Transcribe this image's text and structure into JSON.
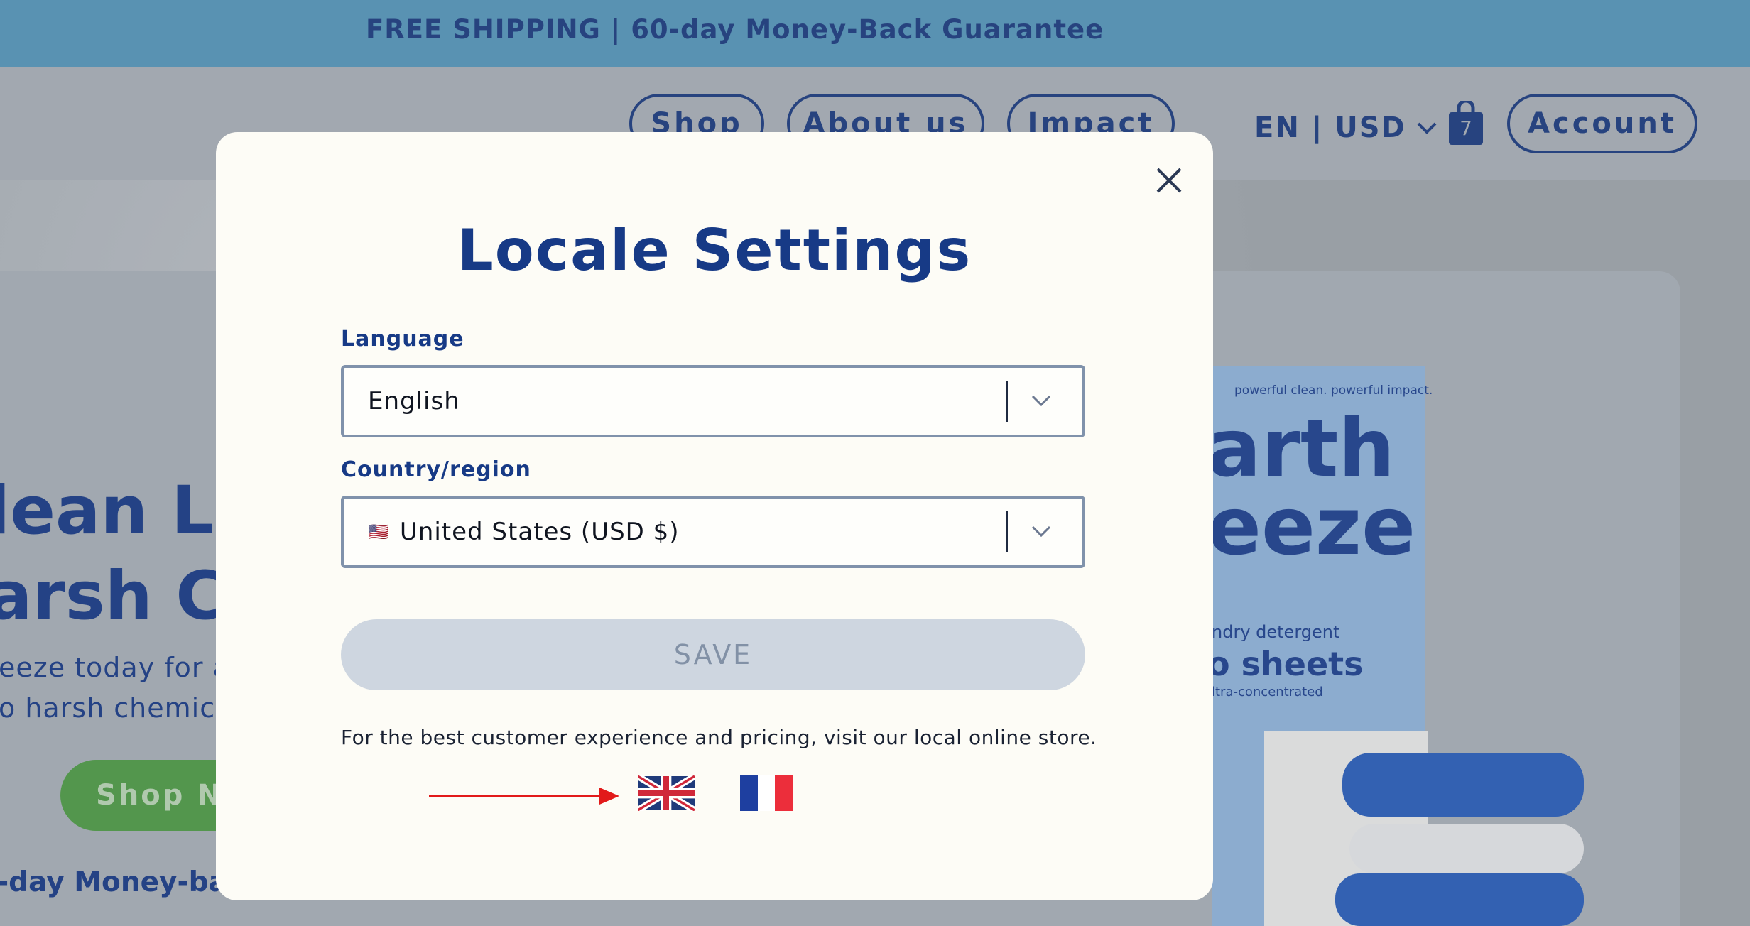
{
  "announcement": {
    "text": "FREE SHIPPING | 60-day Money-Back Guarantee"
  },
  "header": {
    "nav": [
      {
        "label": "Shop"
      },
      {
        "label": "About us"
      },
      {
        "label": "Impact"
      }
    ],
    "locale_toggle": "EN | USD",
    "cart_count": "7",
    "account_label": "Account"
  },
  "hero": {
    "title_line1": "lean Lau",
    "title_line2": "arsh Ch",
    "subtitle_line1": "eeze today for a",
    "subtitle_line2": "o harsh chemic",
    "shop_button": "Shop No",
    "guarantee": "-day Money-ba",
    "product": {
      "tagline": "powerful clean. powerful impact.",
      "brand_line1": "arth",
      "brand_line2": "eeze",
      "detergent": "ndry detergent",
      "sheets": "o sheets",
      "concentrated": "ltra-concentrated"
    }
  },
  "modal": {
    "title": "Locale Settings",
    "language_label": "Language",
    "language_value": "English",
    "country_label": "Country/region",
    "country_flag": "🇺🇸",
    "country_value": "United States (USD $)",
    "save_label": "SAVE",
    "store_note": "For the best customer experience and pricing, visit our local online store."
  },
  "colors": {
    "brand_blue": "#173a86",
    "announcement_bg": "#5595b8",
    "save_disabled_bg": "#ced6e0",
    "shop_green": "#4e9945"
  }
}
